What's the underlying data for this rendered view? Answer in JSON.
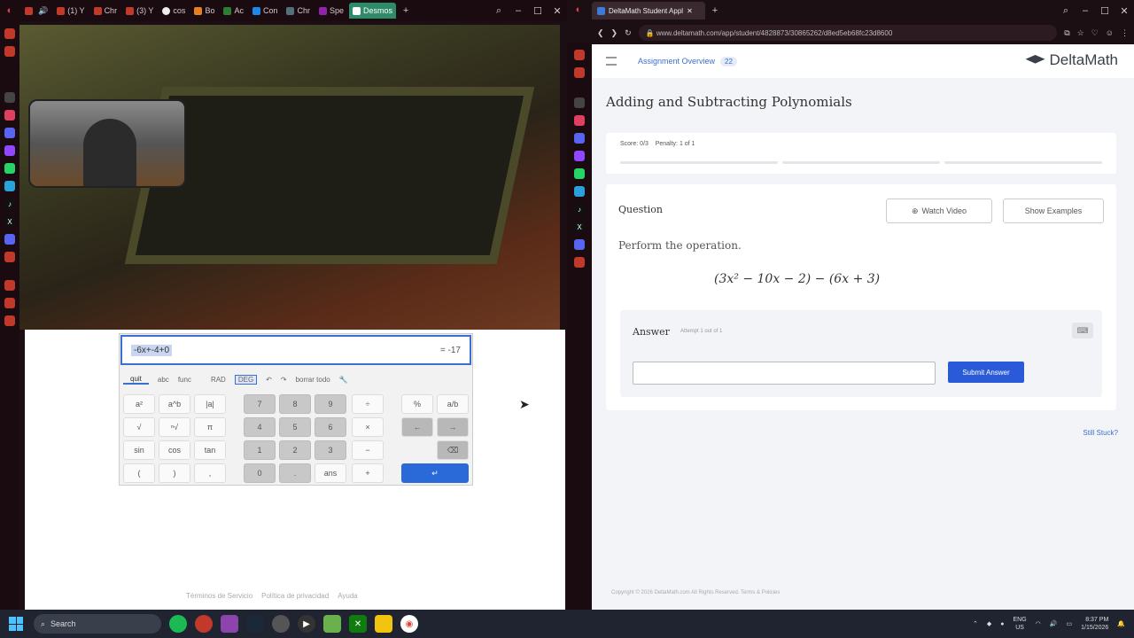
{
  "left_browser": {
    "tabs": [
      {
        "label": "",
        "icon": "youtube-icon",
        "color": "#e53935"
      },
      {
        "label": "(1) Y",
        "icon": "youtube-icon",
        "color": "#e53935"
      },
      {
        "label": "Chr",
        "icon": "youtube-icon",
        "color": "#e53935"
      },
      {
        "label": "(3) Y",
        "icon": "youtube-icon",
        "color": "#e53935"
      },
      {
        "label": "cos",
        "icon": "google-icon",
        "color": "#eeeeee"
      },
      {
        "label": "Bo",
        "icon": "app-icon",
        "color": "#e67e22"
      },
      {
        "label": "Ac",
        "icon": "app-icon",
        "color": "#2e7d32"
      },
      {
        "label": "Con",
        "icon": "app-icon",
        "color": "#1e88e5"
      },
      {
        "label": "Chr",
        "icon": "app-icon",
        "color": "#546e7a"
      },
      {
        "label": "Spe",
        "icon": "app-icon",
        "color": "#8e24aa"
      },
      {
        "label": "Desmos",
        "icon": "desmos-icon",
        "color": "#2e8b6a"
      }
    ],
    "calculator": {
      "expression": "-6x+-4+0",
      "result": "= -17",
      "tabs": [
        "quit",
        "abc",
        "func"
      ],
      "mode_rad": "RAD",
      "mode_deg": "DEG",
      "clear_all": "borrar todo",
      "keys": {
        "row1": [
          "a²",
          "a^b",
          "|a|",
          "7",
          "8",
          "9",
          "÷",
          "%",
          "a/b"
        ],
        "row2": [
          "√",
          "ⁿ√",
          "π",
          "4",
          "5",
          "6",
          "×",
          "←",
          "→"
        ],
        "row3": [
          "sin",
          "cos",
          "tan",
          "1",
          "2",
          "3",
          "−",
          "⌫"
        ],
        "row4": [
          "(",
          ")",
          ",",
          "0",
          ".",
          "ans",
          "+",
          "↵"
        ]
      }
    },
    "footer": [
      "Términos de Servicio",
      "Política de privacidad",
      "Ayuda"
    ]
  },
  "right_browser": {
    "tab_title": "DeltaMath Student Appl",
    "url": "www.deltamath.com/app/student/4828873/30865262/d8ed5eb68fc23d8600",
    "breadcrumb": "Assignment Overview",
    "badge": "22",
    "logo": "DeltaMath",
    "assignment_title": "Adding and Subtracting Polynomials",
    "score": "Score: 0/3",
    "penalty": "Penalty: 1 of 1",
    "question_label": "Question",
    "watch_video": "Watch Video",
    "show_examples": "Show Examples",
    "prompt": "Perform the operation.",
    "expression": "(3x² − 10x − 2) − (6x + 3)",
    "answer_label": "Answer",
    "attempt": "Attempt 1 out of 1",
    "submit": "Submit Answer",
    "stuck": "Still Stuck?",
    "copyright": "Copyright © 2026 DeltaMath.com All Rights Reserved. Terms & Policies"
  },
  "taskbar": {
    "search": "Search",
    "lang_top": "ENG",
    "lang_bottom": "US",
    "time": "8:37 PM",
    "date": "1/15/2026"
  },
  "colors": {
    "accent_blue": "#2a5ad8",
    "desmos_green": "#2e8b6a",
    "chrome_bg": "#1c0f14"
  }
}
